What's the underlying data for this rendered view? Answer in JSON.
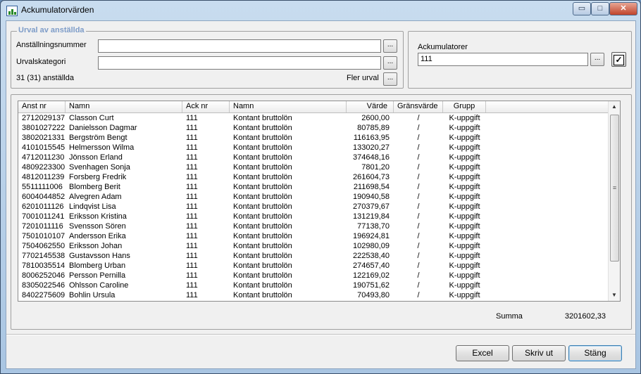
{
  "window": {
    "title": "Ackumulatorvärden",
    "min": "▭",
    "max": "□",
    "close": "✕"
  },
  "urval": {
    "legend": "Urval av anställda",
    "anst_label": "Anställningsnummer",
    "anst_value": "",
    "kat_label": "Urvalskategori",
    "kat_value": "",
    "count_text": "31 (31) anställda",
    "fler_label": "Fler urval",
    "dots": "..."
  },
  "ack": {
    "label": "Ackumulatorer",
    "value": "111",
    "dots": "...",
    "check": "✓"
  },
  "table": {
    "columns": [
      "Anst nr",
      "Namn",
      "Ack nr",
      "Namn",
      "Värde",
      "Gränsvärde",
      "Grupp"
    ],
    "rows": [
      [
        "2712029137",
        "Classon Curt",
        "111",
        "Kontant bruttolön",
        "2600,00",
        "/",
        "K-uppgift"
      ],
      [
        "3801027222",
        "Danielsson Dagmar",
        "111",
        "Kontant bruttolön",
        "80785,89",
        "/",
        "K-uppgift"
      ],
      [
        "3802021331",
        "Bergström Bengt",
        "111",
        "Kontant bruttolön",
        "116163,95",
        "/",
        "K-uppgift"
      ],
      [
        "4101015545",
        "Helmersson Wilma",
        "111",
        "Kontant bruttolön",
        "133020,27",
        "/",
        "K-uppgift"
      ],
      [
        "4712011230",
        "Jönsson Erland",
        "111",
        "Kontant bruttolön",
        "374648,16",
        "/",
        "K-uppgift"
      ],
      [
        "4809223300",
        "Svenhagen Sonja",
        "111",
        "Kontant bruttolön",
        "7801,20",
        "/",
        "K-uppgift"
      ],
      [
        "4812011239",
        "Forsberg Fredrik",
        "111",
        "Kontant bruttolön",
        "261604,73",
        "/",
        "K-uppgift"
      ],
      [
        "5511111006",
        "Blomberg Berit",
        "111",
        "Kontant bruttolön",
        "211698,54",
        "/",
        "K-uppgift"
      ],
      [
        "6004044852",
        "Alvegren Adam",
        "111",
        "Kontant bruttolön",
        "190940,58",
        "/",
        "K-uppgift"
      ],
      [
        "6201011126",
        "Lindqvist Lisa",
        "111",
        "Kontant bruttolön",
        "270379,67",
        "/",
        "K-uppgift"
      ],
      [
        "7001011241",
        "Eriksson Kristina",
        "111",
        "Kontant bruttolön",
        "131219,84",
        "/",
        "K-uppgift"
      ],
      [
        "7201011116",
        "Svensson Sören",
        "111",
        "Kontant bruttolön",
        "77138,70",
        "/",
        "K-uppgift"
      ],
      [
        "7501010107",
        "Andersson Erika",
        "111",
        "Kontant bruttolön",
        "196924,81",
        "/",
        "K-uppgift"
      ],
      [
        "7504062550",
        "Eriksson Johan",
        "111",
        "Kontant bruttolön",
        "102980,09",
        "/",
        "K-uppgift"
      ],
      [
        "7702145538",
        "Gustavsson Hans",
        "111",
        "Kontant bruttolön",
        "222538,40",
        "/",
        "K-uppgift"
      ],
      [
        "7810035514",
        "Blomberg Urban",
        "111",
        "Kontant bruttolön",
        "274657,40",
        "/",
        "K-uppgift"
      ],
      [
        "8006252046",
        "Persson Pernilla",
        "111",
        "Kontant bruttolön",
        "122169,02",
        "/",
        "K-uppgift"
      ],
      [
        "8305022546",
        "Ohlsson Caroline",
        "111",
        "Kontant bruttolön",
        "190751,62",
        "/",
        "K-uppgift"
      ],
      [
        "8402275609",
        "Bohlin Ursula",
        "111",
        "Kontant bruttolön",
        "70493,80",
        "/",
        "K-uppgift"
      ]
    ]
  },
  "summa": {
    "label": "Summa",
    "value": "3201602,33"
  },
  "scroll": {
    "up": "▲",
    "down": "▼",
    "grip": "≡"
  },
  "buttons": {
    "excel": "Excel",
    "skriv": "Skriv ut",
    "stang": "Stäng"
  }
}
